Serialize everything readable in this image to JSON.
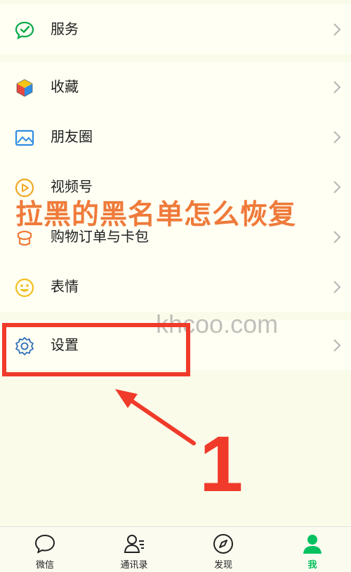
{
  "menu": {
    "items": [
      {
        "id": "services",
        "label": "服务",
        "icon": "wechat-pay-check-icon"
      },
      {
        "id": "favorites",
        "label": "收藏",
        "icon": "cube-icon"
      },
      {
        "id": "moments",
        "label": "朋友圈",
        "icon": "image-icon"
      },
      {
        "id": "channels",
        "label": "视频号",
        "icon": "play-circle-icon"
      },
      {
        "id": "orders",
        "label": "购物订单与卡包",
        "icon": "bag-icon"
      },
      {
        "id": "stickers",
        "label": "表情",
        "icon": "smile-icon"
      },
      {
        "id": "settings",
        "label": "设置",
        "icon": "gear-icon"
      }
    ]
  },
  "overlay": {
    "title": "拉黑的黑名单怎么恢复",
    "watermark": "khcoo.com",
    "step_number": "1"
  },
  "tabbar": {
    "tabs": [
      {
        "label": "微信",
        "icon": "chat-bubble-icon",
        "active": false
      },
      {
        "label": "通讯录",
        "icon": "contacts-icon",
        "active": false
      },
      {
        "label": "发现",
        "icon": "compass-icon",
        "active": false
      },
      {
        "label": "我",
        "icon": "person-icon",
        "active": true
      }
    ]
  },
  "colors": {
    "accent": "#07c160",
    "annotation_red": "#f03a2a",
    "overlay_orange": "#ef7a3a",
    "background": "#fbfbe9"
  }
}
